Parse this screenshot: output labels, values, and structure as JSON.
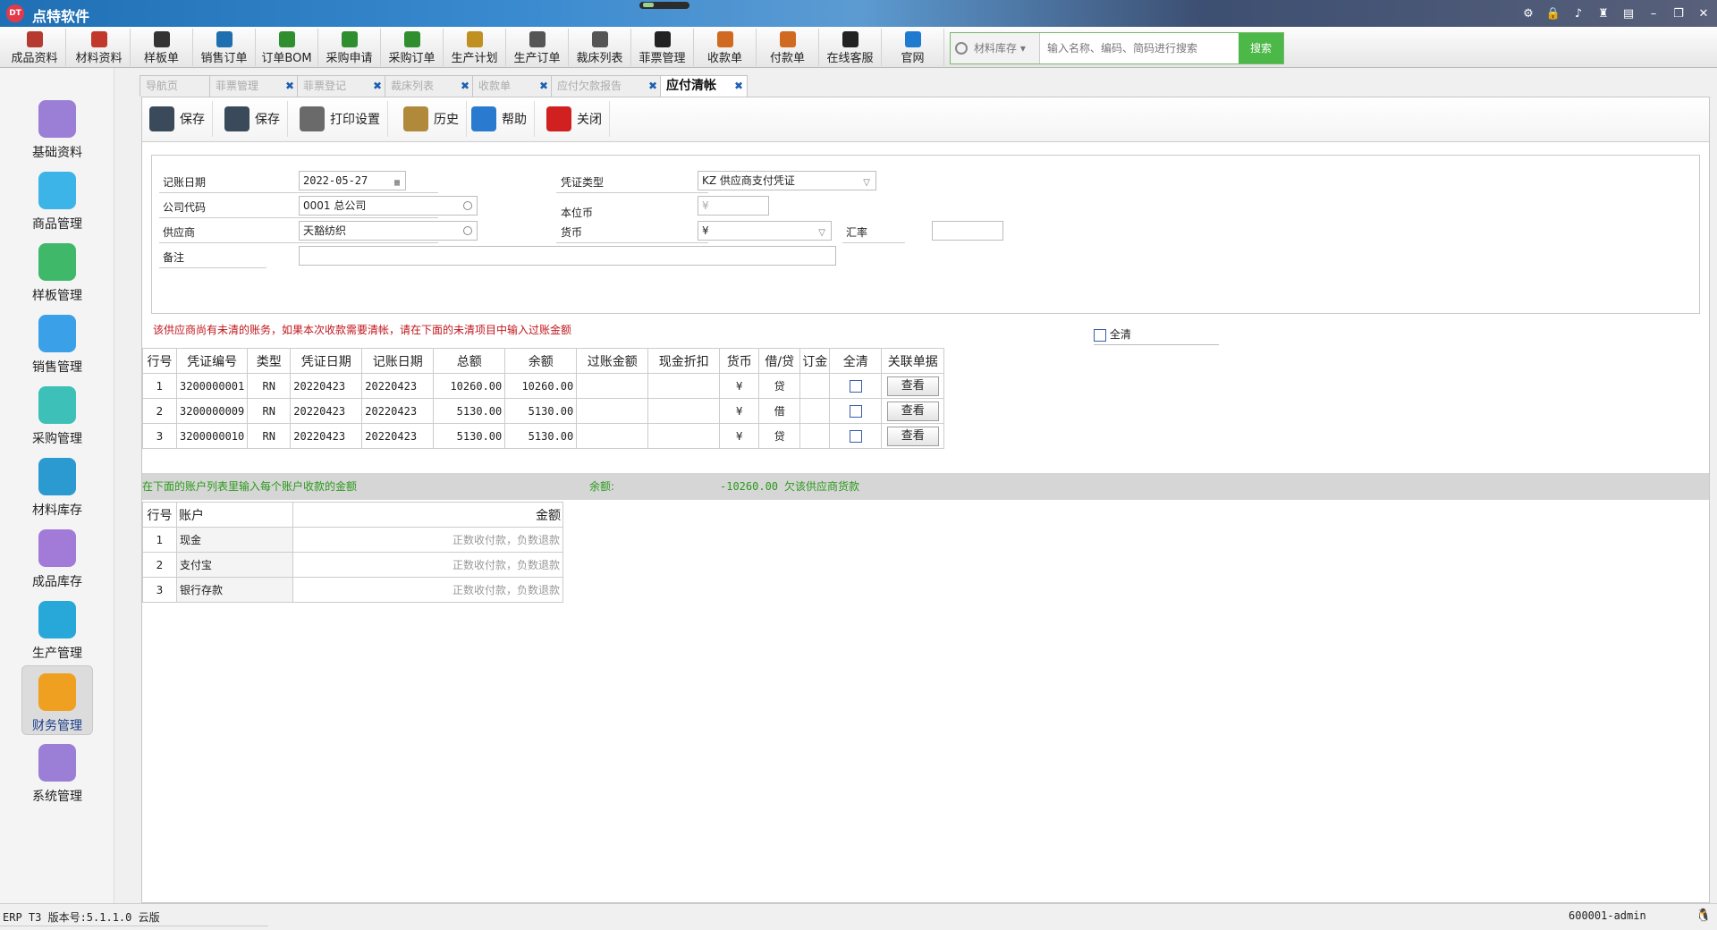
{
  "app": {
    "title": "点特软件",
    "logo": "DT"
  },
  "toolbar": [
    {
      "label": "成品资料",
      "icon": "garment-icon",
      "color": "#b53a2f"
    },
    {
      "label": "材料资料",
      "icon": "material-icon",
      "color": "#c0392b"
    },
    {
      "label": "样板单",
      "icon": "pattern-icon",
      "color": "#333"
    },
    {
      "label": "销售订单",
      "icon": "sales-order-icon",
      "color": "#1e6fb0"
    },
    {
      "label": "订单BOM",
      "icon": "bom-icon",
      "color": "#2f8f2f"
    },
    {
      "label": "采购申请",
      "icon": "purchase-request-icon",
      "color": "#2f8f2f"
    },
    {
      "label": "采购订单",
      "icon": "purchase-order-icon",
      "color": "#2f8f2f"
    },
    {
      "label": "生产计划",
      "icon": "production-plan-icon",
      "color": "#c09020"
    },
    {
      "label": "生产订单",
      "icon": "production-order-icon",
      "color": "#555"
    },
    {
      "label": "裁床列表",
      "icon": "cutting-icon",
      "color": "#555"
    },
    {
      "label": "菲票管理",
      "icon": "qr-icon",
      "color": "#222"
    },
    {
      "label": "收款单",
      "icon": "receipt-icon",
      "color": "#d06a20"
    },
    {
      "label": "付款单",
      "icon": "payment-icon",
      "color": "#d06a20"
    },
    {
      "label": "在线客服",
      "icon": "qq-icon",
      "color": "#222"
    },
    {
      "label": "官网",
      "icon": "ie-icon",
      "color": "#1e7bd0"
    }
  ],
  "search": {
    "category": "材料库存",
    "placeholder": "输入名称、编码、简码进行搜索",
    "button": "搜索"
  },
  "sidebar": [
    {
      "label": "基础资料",
      "icon": "basic-data-icon",
      "color": "#9b7fd6"
    },
    {
      "label": "商品管理",
      "icon": "goods-icon",
      "color": "#3cb4e8"
    },
    {
      "label": "样板管理",
      "icon": "pattern-manage-icon",
      "color": "#3fb86a"
    },
    {
      "label": "销售管理",
      "icon": "cart-icon",
      "color": "#3aa0e8"
    },
    {
      "label": "采购管理",
      "icon": "truck-icon",
      "color": "#3cc0b8"
    },
    {
      "label": "材料库存",
      "icon": "warehouse-icon",
      "color": "#2a9ad0"
    },
    {
      "label": "成品库存",
      "icon": "product-stock-icon",
      "color": "#a27ad8"
    },
    {
      "label": "生产管理",
      "icon": "tools-icon",
      "color": "#28a8d8"
    },
    {
      "label": "财务管理",
      "icon": "finance-icon",
      "color": "#f0a020"
    },
    {
      "label": "系统管理",
      "icon": "settings-icon",
      "color": "#9b7fd6"
    }
  ],
  "tabs": [
    {
      "label": "导航页",
      "closable": false
    },
    {
      "label": "菲票管理",
      "closable": true
    },
    {
      "label": "菲票登记",
      "closable": true
    },
    {
      "label": "裁床列表",
      "closable": true
    },
    {
      "label": "收款单",
      "closable": true
    },
    {
      "label": "应付欠款报告",
      "closable": true
    },
    {
      "label": "应付清帐",
      "closable": true
    }
  ],
  "actions": [
    {
      "label": "保存",
      "icon": "save-icon",
      "color": "#3a4a5a"
    },
    {
      "label": "保存",
      "icon": "save-icon",
      "color": "#3a4a5a"
    },
    {
      "label": "打印设置",
      "icon": "printer-icon",
      "color": "#6a6a6a"
    },
    {
      "label": "历史",
      "icon": "history-icon",
      "color": "#b08a3a"
    },
    {
      "label": "帮助",
      "icon": "help-icon",
      "color": "#2a7ad0"
    },
    {
      "label": "关闭",
      "icon": "close-icon",
      "color": "#d02020"
    }
  ],
  "form": {
    "date_label": "记账日期",
    "date_value": "2022-05-27",
    "company_label": "公司代码",
    "company_value": "0001 总公司",
    "supplier_label": "供应商",
    "supplier_value": "天豁纺织",
    "remark_label": "备注",
    "remark_value": "",
    "voucher_type_label": "凭证类型",
    "voucher_type_value": "KZ 供应商支付凭证",
    "base_currency_label": "本位币",
    "base_currency_value": "¥",
    "currency_label": "货币",
    "currency_value": "¥",
    "rate_label": "汇率",
    "rate_value": ""
  },
  "warning": "该供应商尚有未清的账务，如果本次收款需要清帐，请在下面的未清项目中输入过账金额",
  "all_clear_label": "全清",
  "items_table": {
    "headers": [
      "行号",
      "凭证编号",
      "类型",
      "凭证日期",
      "记账日期",
      "总额",
      "余额",
      "过账金额",
      "现金折扣",
      "货币",
      "借/贷",
      "订金",
      "全清",
      "关联单据"
    ],
    "rows": [
      {
        "no": "1",
        "voucher": "3200000001",
        "type": "RN",
        "vdate": "20220423",
        "pdate": "20220423",
        "total": "10260.00",
        "balance": "10260.00",
        "post": "",
        "discount": "",
        "currency": "¥",
        "dc": "贷",
        "deposit": "",
        "view": "查看"
      },
      {
        "no": "2",
        "voucher": "3200000009",
        "type": "RN",
        "vdate": "20220423",
        "pdate": "20220423",
        "total": "5130.00",
        "balance": "5130.00",
        "post": "",
        "discount": "",
        "currency": "¥",
        "dc": "借",
        "deposit": "",
        "view": "查看"
      },
      {
        "no": "3",
        "voucher": "3200000010",
        "type": "RN",
        "vdate": "20220423",
        "pdate": "20220423",
        "total": "5130.00",
        "balance": "5130.00",
        "post": "",
        "discount": "",
        "currency": "¥",
        "dc": "贷",
        "deposit": "",
        "view": "查看"
      }
    ]
  },
  "summary": {
    "hint": "在下面的账户列表里输入每个账户收款的金额",
    "balance_label": "余额:",
    "balance_value": "-10260.00",
    "balance_note": "欠该供应商货款"
  },
  "accounts_table": {
    "headers": [
      "行号",
      "账户",
      "金额"
    ],
    "placeholder": "正数收付款，负数退款",
    "rows": [
      {
        "no": "1",
        "account": "现金"
      },
      {
        "no": "2",
        "account": "支付宝"
      },
      {
        "no": "3",
        "account": "银行存款"
      }
    ]
  },
  "status": {
    "version": "ERP T3 版本号:5.1.1.0 云版",
    "user": "600001-admin"
  }
}
